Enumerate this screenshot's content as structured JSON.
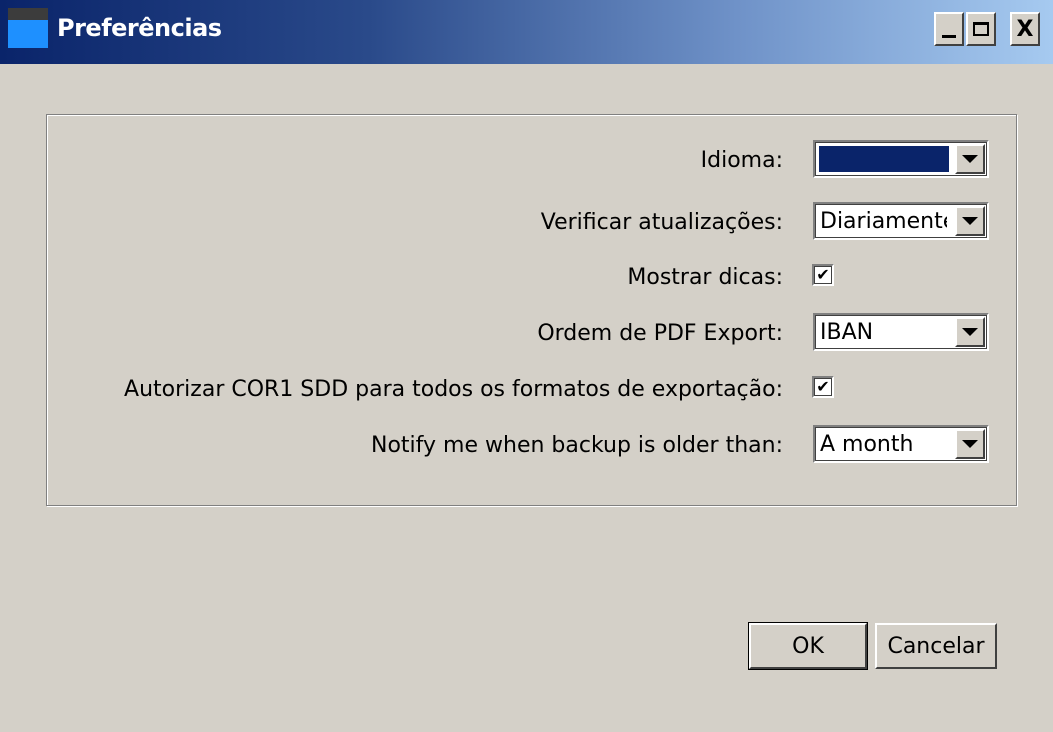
{
  "window": {
    "title": "Preferências",
    "controls": {
      "minimize": "minimize-icon",
      "maximize": "maximize-icon",
      "close": "X"
    }
  },
  "form": {
    "language": {
      "label": "Idioma:",
      "value": ""
    },
    "check_updates": {
      "label": "Verificar atualizações:",
      "value": "Diariamente"
    },
    "show_tips": {
      "label": "Mostrar dicas:",
      "checked": true
    },
    "pdf_export_order": {
      "label": "Ordem de PDF Export:",
      "value": "IBAN"
    },
    "authorize_cor1": {
      "label": "Autorizar COR1 SDD para todos os formatos de exportação:",
      "checked": true
    },
    "backup_notify": {
      "label": "Notify me when backup is older than:",
      "value": "A month"
    }
  },
  "buttons": {
    "ok": "OK",
    "cancel": "Cancelar"
  },
  "colors": {
    "selection": "#0a246a",
    "window_bg": "#d4d0c8"
  }
}
